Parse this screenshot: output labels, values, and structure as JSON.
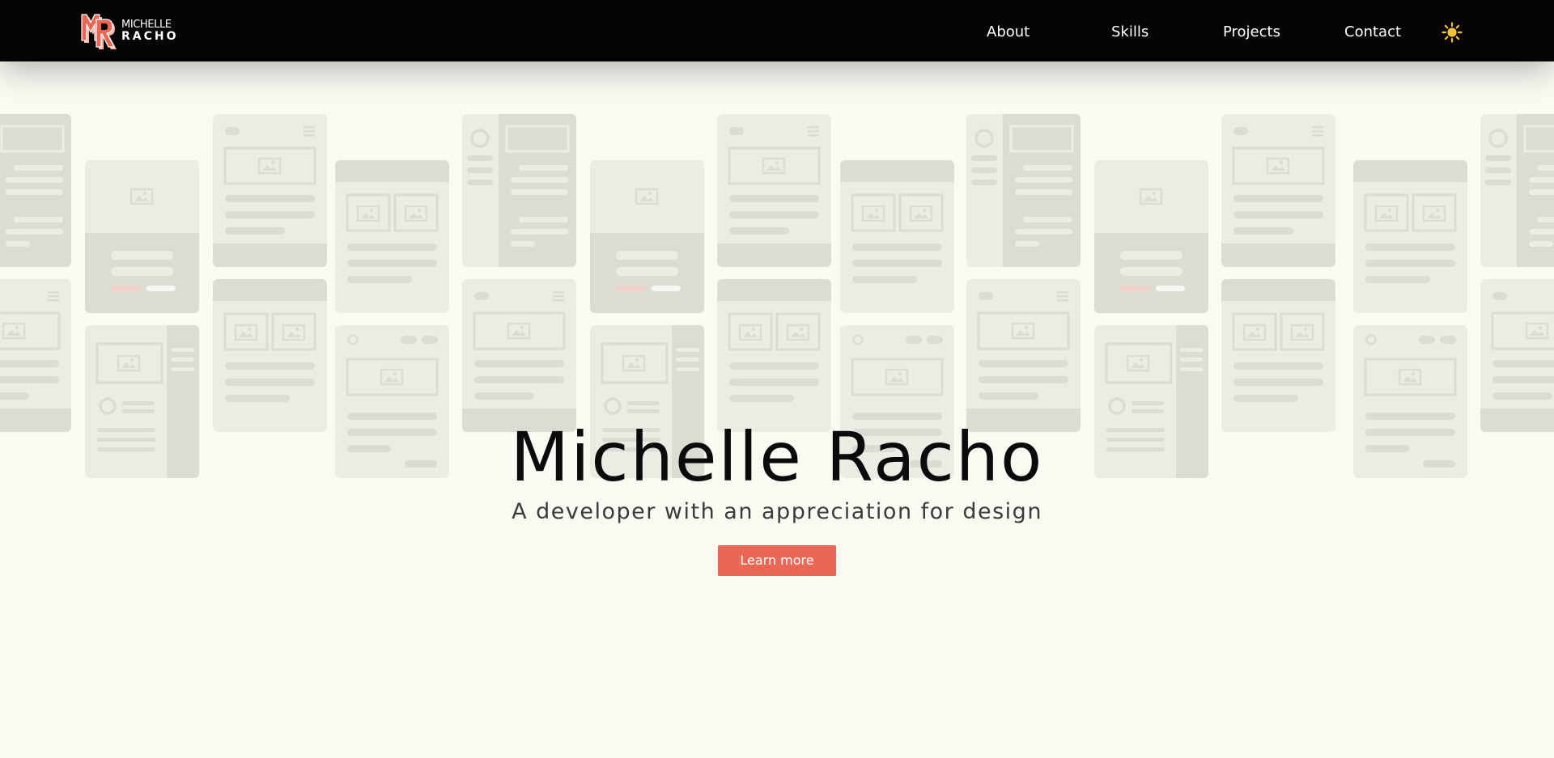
{
  "brand": {
    "line1": "MICHELLE",
    "line2": "RACHO",
    "colors": {
      "primary": "#ea6756",
      "shadow": "#f4b7ad"
    }
  },
  "nav": {
    "items": [
      {
        "label": "About"
      },
      {
        "label": "Skills"
      },
      {
        "label": "Projects"
      },
      {
        "label": "Contact"
      }
    ],
    "theme_toggle_icon": "sun-icon",
    "theme_toggle_color": "#f3c13c"
  },
  "hero": {
    "title": "Michelle Racho",
    "subtitle": "A developer with an appreciation for design",
    "cta_label": "Learn more",
    "cta_color": "#ea6756"
  },
  "background": {
    "pattern_icon": "wireframe-mockup-cards",
    "card_color": "#ecebe4",
    "detail_color": "#dcdbd4"
  }
}
